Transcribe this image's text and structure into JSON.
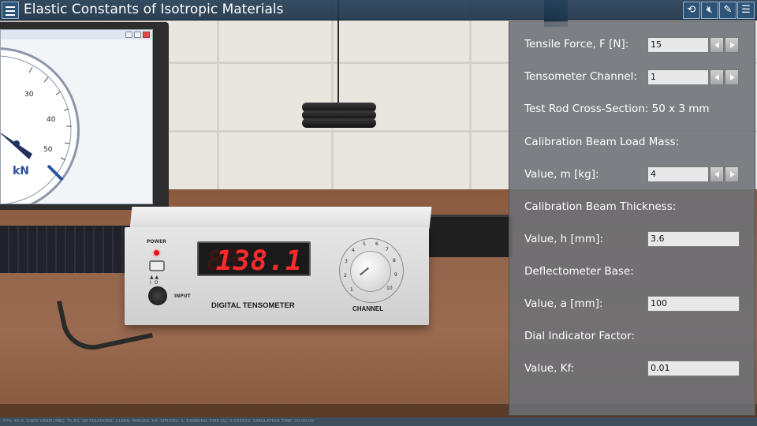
{
  "app": {
    "title": "Elastic Constants of Isotropic Materials"
  },
  "toolbar": {
    "icons": [
      "menu-icon",
      "reset-icon",
      "mute-icon",
      "notebook-icon",
      "list-icon"
    ]
  },
  "scene": {
    "gauge": {
      "ticks": [
        "30",
        "40",
        "50"
      ],
      "unit": "kN"
    },
    "tensometer": {
      "display": "138.1",
      "ghost": "88",
      "power_label": "POWER",
      "switch_marks": "▲ ▲\nI  O",
      "input_label": "INPUT",
      "title": "DIGITAL TENSOMETER",
      "channel_label": "CHANNEL",
      "channel_numbers": [
        "1",
        "2",
        "3",
        "4",
        "5",
        "6",
        "7",
        "8",
        "9",
        "10"
      ]
    },
    "status_text": "FPS: 45.6; USED VRAM [MB]: 75.83; 3D POLYGONS: 21808; IMAGES: 64; SPRITES: 5; DRAWING TIME [S]: 0.003933; SIMULATION TIME: 00:00:00"
  },
  "panel": {
    "tensile_force": {
      "label": "Tensile Force, F [N]:",
      "value": "15"
    },
    "tensometer_channel": {
      "label": "Tensometer Channel:",
      "value": "1"
    },
    "cross_section": {
      "label": "Test Rod Cross-Section: 50 x 3 mm"
    },
    "beam_load_mass": {
      "heading": "Calibration Beam Load Mass:",
      "label": "Value, m [kg]:",
      "value": "4"
    },
    "beam_thickness": {
      "heading": "Calibration Beam Thickness:",
      "label": "Value, h [mm]:",
      "value": "3.6"
    },
    "deflectometer_base": {
      "heading": "Deflectometer Base:",
      "label": "Value, a [mm]:",
      "value": "100"
    },
    "dial_indicator": {
      "heading": "Dial Indicator Factor:",
      "label": "Value, Kf:",
      "value": "0.01"
    }
  }
}
